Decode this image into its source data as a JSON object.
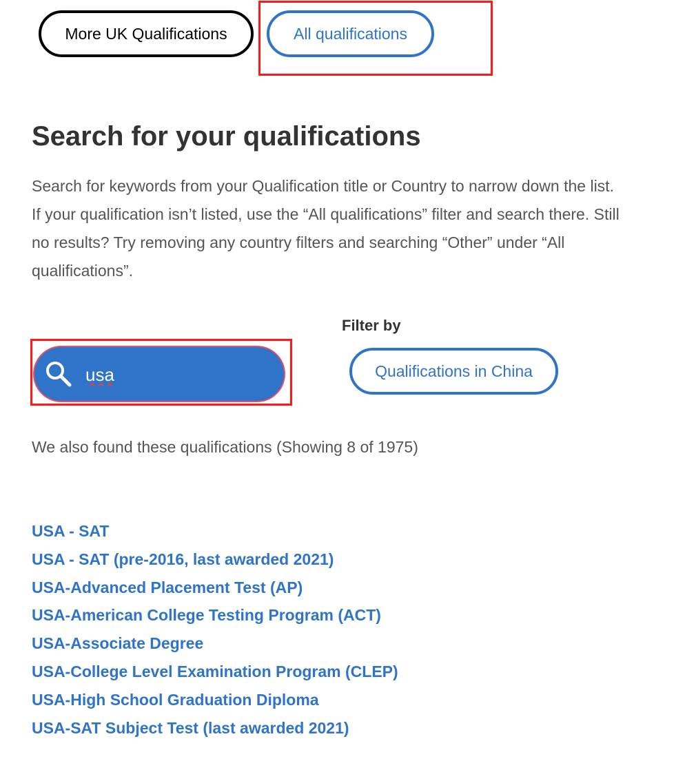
{
  "top_buttons": {
    "more_uk_label": "More UK Qualifications",
    "all_label": "All qualifications"
  },
  "heading": "Search for your qualifications",
  "intro_text": "Search for keywords from your Qualification title or Country to narrow down the list. If your qualification isn’t listed, use the “All qualifications” filter and search there. Still no results? Try removing any country filters and searching “Other” under “All qualifications”.",
  "filter": {
    "label": "Filter by",
    "button_label": "Qualifications in China"
  },
  "search": {
    "value": "usa",
    "icon": "search-icon"
  },
  "results_summary": "We also found these qualifications (Showing 8 of 1975)",
  "results": [
    "USA - SAT",
    "USA - SAT (pre-2016, last awarded 2021)",
    "USA-Advanced Placement Test (AP)",
    "USA-American College Testing Program (ACT)",
    "USA-Associate Degree",
    "USA-College Level Examination Program (CLEP)",
    "USA-High School Graduation Diploma",
    "USA-SAT Subject Test (last awarded 2021)"
  ],
  "colors": {
    "accent": "#2f74c8",
    "annotation": "#ff1a1a"
  }
}
